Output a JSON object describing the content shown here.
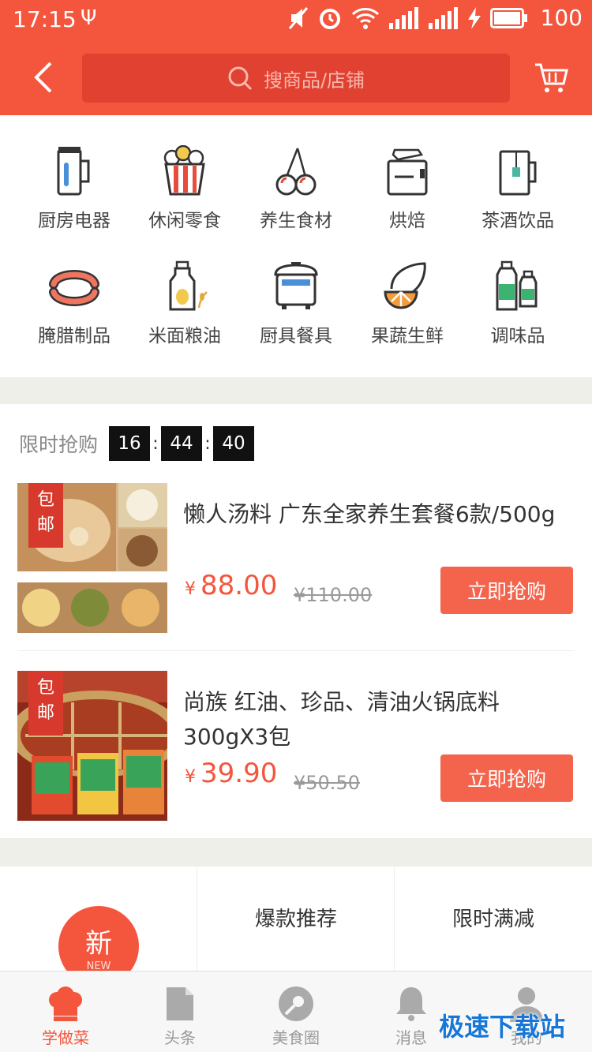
{
  "status": {
    "time": "17:15",
    "battery": "100"
  },
  "header": {
    "search_placeholder": "搜商品/店铺"
  },
  "categories": [
    {
      "label": "厨房电器",
      "icon": "kettle-icon"
    },
    {
      "label": "休闲零食",
      "icon": "popcorn-icon"
    },
    {
      "label": "养生食材",
      "icon": "cherry-icon"
    },
    {
      "label": "烘焙",
      "icon": "toaster-icon"
    },
    {
      "label": "茶酒饮品",
      "icon": "tea-cup-icon"
    },
    {
      "label": "腌腊制品",
      "icon": "sausage-icon"
    },
    {
      "label": "米面粮油",
      "icon": "oil-bottle-icon"
    },
    {
      "label": "厨具餐具",
      "icon": "rice-cooker-icon"
    },
    {
      "label": "果蔬生鲜",
      "icon": "fruit-icon"
    },
    {
      "label": "调味品",
      "icon": "sauce-bottles-icon"
    }
  ],
  "flash_sale": {
    "title": "限时抢购",
    "hours": "16",
    "minutes": "44",
    "seconds": "40",
    "products": [
      {
        "tag_line1": "包",
        "tag_line2": "邮",
        "name": "懒人汤料 广东全家养生套餐6款/500g",
        "currency": "¥",
        "price": "88.00",
        "orig_price": "¥110.00",
        "buy_label": "立即抢购"
      },
      {
        "tag_line1": "包",
        "tag_line2": "邮",
        "name": "尚族 红油、珍品、清油火锅底料300gX3包",
        "currency": "¥",
        "price": "39.90",
        "orig_price": "¥50.50",
        "buy_label": "立即抢购"
      }
    ]
  },
  "promo": {
    "new_label": "新",
    "new_sub": "NEW",
    "hot_label": "爆款推荐",
    "discount_label": "限时满减"
  },
  "tabs": [
    {
      "label": "学做菜",
      "icon": "chef-hat-icon",
      "active": true
    },
    {
      "label": "头条",
      "icon": "document-icon",
      "active": false
    },
    {
      "label": "美食圈",
      "icon": "plate-spoon-icon",
      "active": false
    },
    {
      "label": "消息",
      "icon": "bell-icon",
      "active": false
    },
    {
      "label": "我的",
      "icon": "user-icon",
      "active": false
    }
  ],
  "watermark": "极速下载站",
  "colors": {
    "accent": "#f4553d",
    "search_bg": "#e04130",
    "buy_button": "#f4644d"
  }
}
